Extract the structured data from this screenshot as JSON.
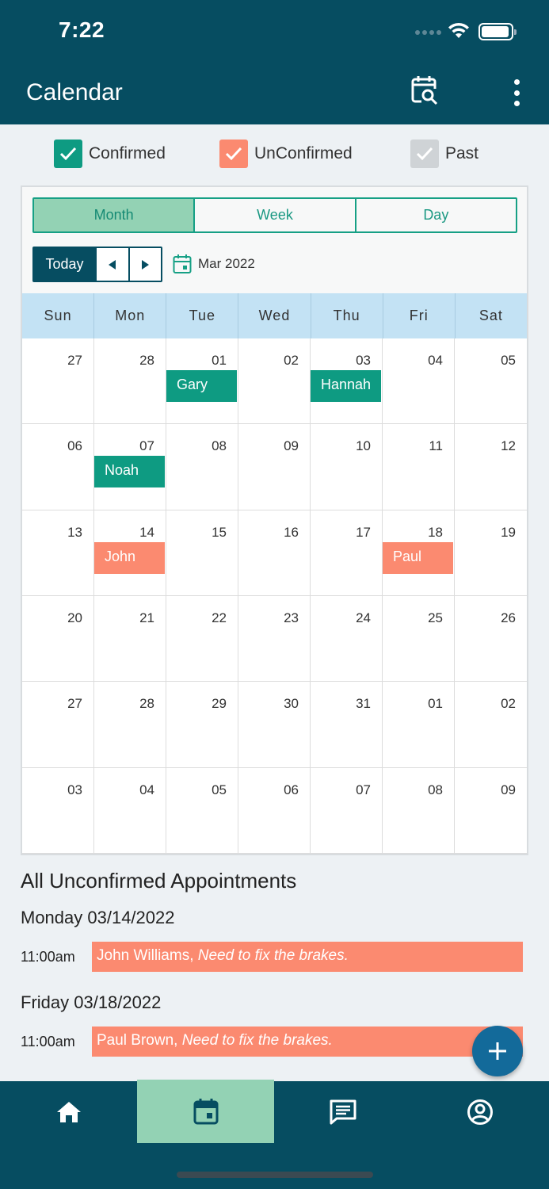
{
  "status_bar": {
    "time": "7:22"
  },
  "header": {
    "title": "Calendar"
  },
  "legend": [
    {
      "label": "Confirmed",
      "color": "#0e9b82"
    },
    {
      "label": "UnConfirmed",
      "color": "#fb8a70"
    },
    {
      "label": "Past",
      "color": "#cfd3d6"
    }
  ],
  "views": {
    "month": "Month",
    "week": "Week",
    "day": "Day"
  },
  "nav": {
    "today": "Today",
    "month_label": "Mar 2022"
  },
  "weekdays": [
    "Sun",
    "Mon",
    "Tue",
    "Wed",
    "Thu",
    "Fri",
    "Sat"
  ],
  "weeks": [
    [
      "27",
      "28",
      "01",
      "02",
      "03",
      "04",
      "05"
    ],
    [
      "06",
      "07",
      "08",
      "09",
      "10",
      "11",
      "12"
    ],
    [
      "13",
      "14",
      "15",
      "16",
      "17",
      "18",
      "19"
    ],
    [
      "20",
      "21",
      "22",
      "23",
      "24",
      "25",
      "26"
    ],
    [
      "27",
      "28",
      "29",
      "30",
      "31",
      "01",
      "02"
    ],
    [
      "03",
      "04",
      "05",
      "06",
      "07",
      "08",
      "09"
    ]
  ],
  "events": [
    {
      "week": 0,
      "day": 2,
      "name": "Gary",
      "status": "confirmed"
    },
    {
      "week": 0,
      "day": 4,
      "name": "Hannah",
      "status": "confirmed"
    },
    {
      "week": 1,
      "day": 1,
      "name": "Noah",
      "status": "confirmed"
    },
    {
      "week": 2,
      "day": 1,
      "name": "John",
      "status": "unconfirmed"
    },
    {
      "week": 2,
      "day": 5,
      "name": "Paul",
      "status": "unconfirmed"
    }
  ],
  "unconfirmed": {
    "title": "All Unconfirmed Appointments",
    "groups": [
      {
        "date": "Monday 03/14/2022",
        "time": "11:00am",
        "name": "John Williams,",
        "note": "Need to fix the brakes."
      },
      {
        "date": "Friday 03/18/2022",
        "time": "11:00am",
        "name": "Paul Brown,",
        "note": "Need to fix the brakes."
      }
    ]
  },
  "bottom_nav": [
    {
      "icon": "home-icon",
      "active": false
    },
    {
      "icon": "calendar-icon",
      "active": true
    },
    {
      "icon": "message-icon",
      "active": false
    },
    {
      "icon": "account-icon",
      "active": false
    }
  ]
}
